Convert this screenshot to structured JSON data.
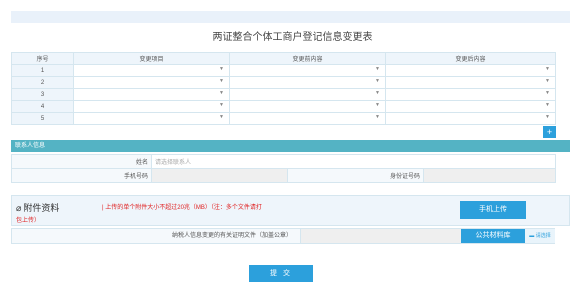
{
  "title": "两证整合个体工商户登记信息变更表",
  "table": {
    "headers": [
      "序号",
      "变更项目",
      "变更前内容",
      "变更后内容"
    ],
    "rows": [
      "1",
      "2",
      "3",
      "4",
      "5"
    ],
    "add_label": "+"
  },
  "contact": {
    "section_title": "联系人信息",
    "name_label": "姓名",
    "name_placeholder": "请选择联系人",
    "phone_label": "手机号码",
    "id_label": "身份证号码"
  },
  "attachments": {
    "title": "附件资料",
    "note_line1": "| 上传的单个附件大小不超过20兆（MB）（注：多个文件请打",
    "note_line2": "包上传）",
    "upload_button": "手机上传",
    "file_label": "纳税人信息变更的有关证明文件（加盖公章）",
    "library_button": "公共材料库",
    "choose_button": "请选择"
  },
  "submit_label": "提 交",
  "colors": {
    "accent": "#2ca0dc",
    "section": "#54b3c4",
    "note": "#e02020"
  },
  "icons": {
    "attach": "paperclip-icon",
    "caret": "caret-down-icon",
    "folder": "folder-icon"
  }
}
